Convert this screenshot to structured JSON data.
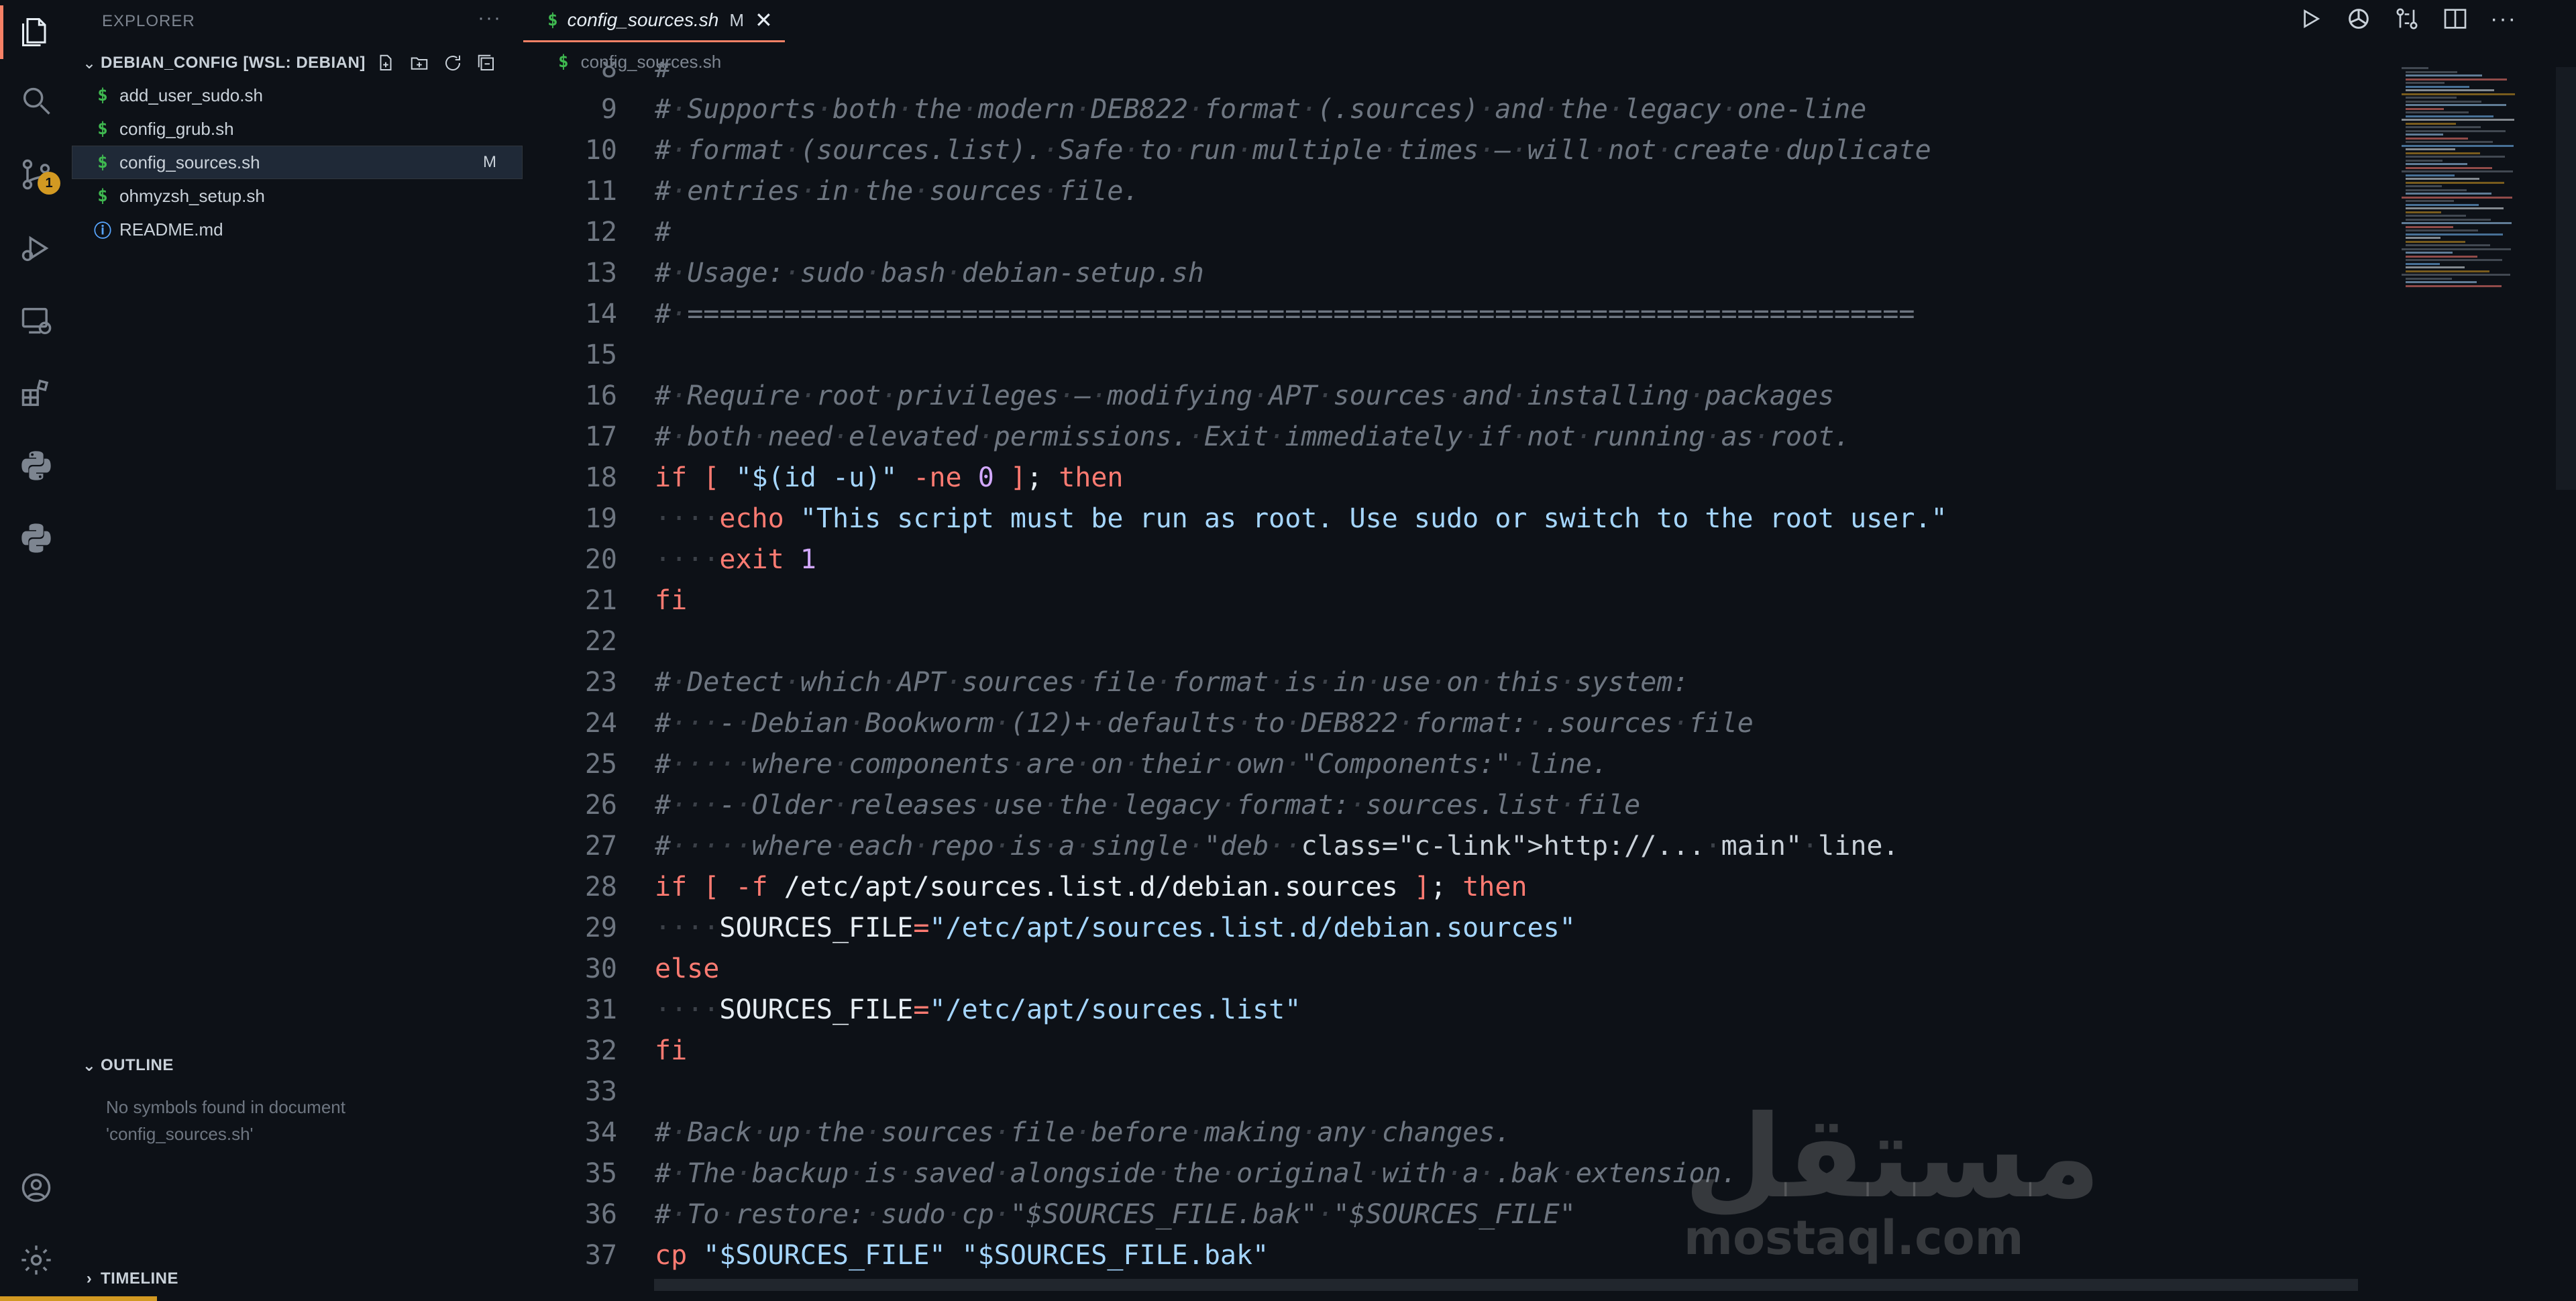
{
  "explorer": {
    "title": "EXPLORER",
    "more": "···",
    "folder": "DEBIAN_CONFIG [WSL: DEBIAN]",
    "files": [
      {
        "icon": "$",
        "name": "add_user_sudo.sh",
        "status": ""
      },
      {
        "icon": "$",
        "name": "config_grub.sh",
        "status": ""
      },
      {
        "icon": "$",
        "name": "config_sources.sh",
        "status": "M"
      },
      {
        "icon": "$",
        "name": "ohmyzsh_setup.sh",
        "status": ""
      },
      {
        "icon": "ⓘ",
        "name": "README.md",
        "status": ""
      }
    ],
    "outline": {
      "title": "OUTLINE",
      "message": "No symbols found in document 'config_sources.sh'"
    },
    "timeline": {
      "title": "TIMELINE"
    }
  },
  "activity": {
    "scm_badge": "1"
  },
  "tab": {
    "icon": "$",
    "name": "config_sources.sh",
    "modified": "M",
    "close": "✕"
  },
  "tab_actions": {
    "more": "···"
  },
  "breadcrumb": {
    "icon": "$",
    "file": "config_sources.sh"
  },
  "editor": {
    "lines": [
      {
        "n": "8",
        "t": "#"
      },
      {
        "n": "9",
        "t": "# Supports both the modern DEB822 format (.sources) and the legacy one-line"
      },
      {
        "n": "10",
        "t": "# format (sources.list). Safe to run multiple times — will not create duplicate"
      },
      {
        "n": "11",
        "t": "# entries in the sources file."
      },
      {
        "n": "12",
        "t": "#"
      },
      {
        "n": "13",
        "t": "# Usage: sudo bash debian-setup.sh"
      },
      {
        "n": "14",
        "t": "# ============================================================================"
      },
      {
        "n": "15",
        "t": ""
      },
      {
        "n": "16",
        "t": "# Require root privileges — modifying APT sources and installing packages"
      },
      {
        "n": "17",
        "t": "# both need elevated permissions. Exit immediately if not running as root."
      },
      {
        "n": "18",
        "t": "if [ \"$(id -u)\" -ne 0 ]; then"
      },
      {
        "n": "19",
        "t": "    echo \"This script must be run as root. Use sudo or switch to the root user.\""
      },
      {
        "n": "20",
        "t": "    exit 1"
      },
      {
        "n": "21",
        "t": "fi"
      },
      {
        "n": "22",
        "t": ""
      },
      {
        "n": "23",
        "t": "# Detect which APT sources file format is in use on this system:"
      },
      {
        "n": "24",
        "t": "#   - Debian Bookworm (12)+ defaults to DEB822 format: .sources file"
      },
      {
        "n": "25",
        "t": "#     where components are on their own \"Components:\" line."
      },
      {
        "n": "26",
        "t": "#   - Older releases use the legacy format: sources.list file"
      },
      {
        "n": "27",
        "t": "#     where each repo is a single \"deb http://... main\" line."
      },
      {
        "n": "28",
        "t": "if [ -f /etc/apt/sources.list.d/debian.sources ]; then"
      },
      {
        "n": "29",
        "t": "    SOURCES_FILE=\"/etc/apt/sources.list.d/debian.sources\""
      },
      {
        "n": "30",
        "t": "else"
      },
      {
        "n": "31",
        "t": "    SOURCES_FILE=\"/etc/apt/sources.list\""
      },
      {
        "n": "32",
        "t": "fi"
      },
      {
        "n": "33",
        "t": ""
      },
      {
        "n": "34",
        "t": "# Back up the sources file before making any changes."
      },
      {
        "n": "35",
        "t": "# The backup is saved alongside the original with a .bak extension."
      },
      {
        "n": "36",
        "t": "# To restore: sudo cp \"$SOURCES_FILE.bak\" \"$SOURCES_FILE\""
      },
      {
        "n": "37",
        "t": "cp \"$SOURCES_FILE\" \"$SOURCES_FILE.bak\""
      }
    ]
  },
  "watermark": {
    "line1": "مستقل",
    "line2": "mostaql.com"
  },
  "colors": {
    "accent": "#f78166",
    "badge": "#d29922",
    "shell_icon": "#3fb950",
    "info_icon": "#58a6ff"
  }
}
